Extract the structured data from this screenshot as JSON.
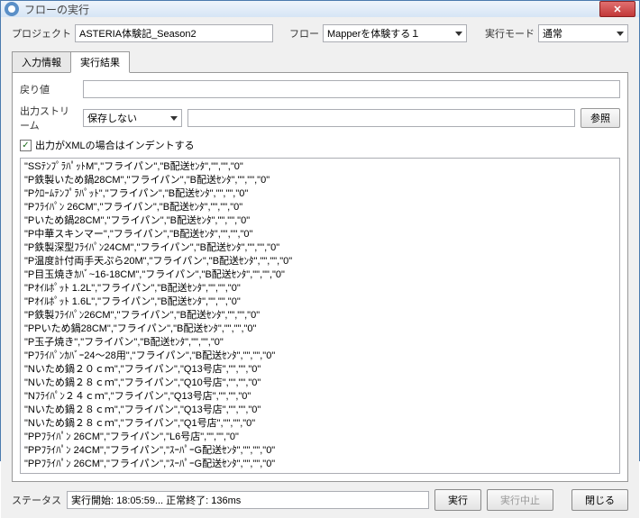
{
  "title": "フローの実行",
  "form": {
    "project_label": "プロジェクト",
    "project_value": "ASTERIA体験記_Season2",
    "flow_label": "フロー",
    "flow_value": "Mapperを体験する１",
    "mode_label": "実行モード",
    "mode_value": "通常"
  },
  "tabs": {
    "input_info": "入力情報",
    "result": "実行結果"
  },
  "result": {
    "return_label": "戻り値",
    "return_value": "",
    "output_stream_label": "出力ストリーム",
    "output_stream_value": "保存しない",
    "browse_label": "参照",
    "indent_label": "出力がXMLの場合はインデントする",
    "lines": [
      "\"SSﾃﾝﾌﾟﾗﾊﾟｯﾄM\",\"フライパン\",\"B配送ｾﾝﾀ\",\"\",\"\",\"0\"",
      "\"P鉄製いため鍋28CM\",\"フライパン\",\"B配送ｾﾝﾀ\",\"\",\"\",\"0\"",
      "\"Pｸﾛｰﾑﾃﾝﾌﾟﾗﾊﾟｯﾄ\",\"フライパン\",\"B配送ｾﾝﾀ\",\"\",\"\",\"0\"",
      "\"Pﾌﾗｲﾊﾟﾝ 26CM\",\"フライパン\",\"B配送ｾﾝﾀ\",\"\",\"\",\"0\"",
      "\"Pいため鍋28CM\",\"フライパン\",\"B配送ｾﾝﾀ\",\"\",\"\",\"0\"",
      "\"P中華スキンマー\",\"フライパン\",\"B配送ｾﾝﾀ\",\"\",\"\",\"0\"",
      "\"P鉄製深型ﾌﾗｲﾊﾟﾝ24CM\",\"フライパン\",\"B配送ｾﾝﾀ\",\"\",\"\",\"0\"",
      "\"P温度計付両手天ぷら20M\",\"フライパン\",\"B配送ｾﾝﾀ\",\"\",\"\",\"0\"",
      "\"P目玉焼きｶﾊﾞ~16-18CM\",\"フライパン\",\"B配送ｾﾝﾀ\",\"\",\"\",\"0\"",
      "\"Pｵｲﾙﾎﾟｯﾄ 1.2L\",\"フライパン\",\"B配送ｾﾝﾀ\",\"\",\"\",\"0\"",
      "\"Pｵｲﾙﾎﾟｯﾄ 1.6L\",\"フライパン\",\"B配送ｾﾝﾀ\",\"\",\"\",\"0\"",
      "\"P鉄製ﾌﾗｲﾊﾟﾝ26CM\",\"フライパン\",\"B配送ｾﾝﾀ\",\"\",\"\",\"0\"",
      "\"PPいため鍋28CM\",\"フライパン\",\"B配送ｾﾝﾀ\",\"\",\"\",\"0\"",
      "\"P玉子焼き\",\"フライパン\",\"B配送ｾﾝﾀ\",\"\",\"\",\"0\"",
      "\"Pﾌﾗｲﾊﾟﾝｶﾊﾞｰ24～28用\",\"フライパン\",\"B配送ｾﾝﾀ\",\"\",\"\",\"0\"",
      "\"Nいため鍋２０ｃｍ\",\"フライパン\",\"Q13号店\",\"\",\"\",\"0\"",
      "\"Nいため鍋２８ｃｍ\",\"フライパン\",\"Q10号店\",\"\",\"\",\"0\"",
      "\"Nﾌﾗｲﾊﾟﾝ２４ｃｍ\",\"フライパン\",\"Q13号店\",\"\",\"\",\"0\"",
      "\"Nいため鍋２８ｃｍ\",\"フライパン\",\"Q13号店\",\"\",\"\",\"0\"",
      "\"Nいため鍋２８ｃｍ\",\"フライパン\",\"Q1号店\",\"\",\"\",\"0\"",
      "\"PPﾌﾗｲﾊﾟﾝ 26CM\",\"フライパン\",\"L6号店\",\"\",\"\",\"0\"",
      "\"PPﾌﾗｲﾊﾟﾝ 24CM\",\"フライパン\",\"ｽｰﾊﾟｰG配送ｾﾝﾀ\",\"\",\"\",\"0\"",
      "\"PPﾌﾗｲﾊﾟﾝ 26CM\",\"フライパン\",\"ｽｰﾊﾟｰG配送ｾﾝﾀ\",\"\",\"\",\"0\""
    ]
  },
  "bottom": {
    "status_label": "ステータス",
    "status_value": "実行開始: 18:05:59... 正常終了: 136ms",
    "run_label": "実行",
    "cancel_label": "実行中止",
    "close_label": "閉じる"
  }
}
